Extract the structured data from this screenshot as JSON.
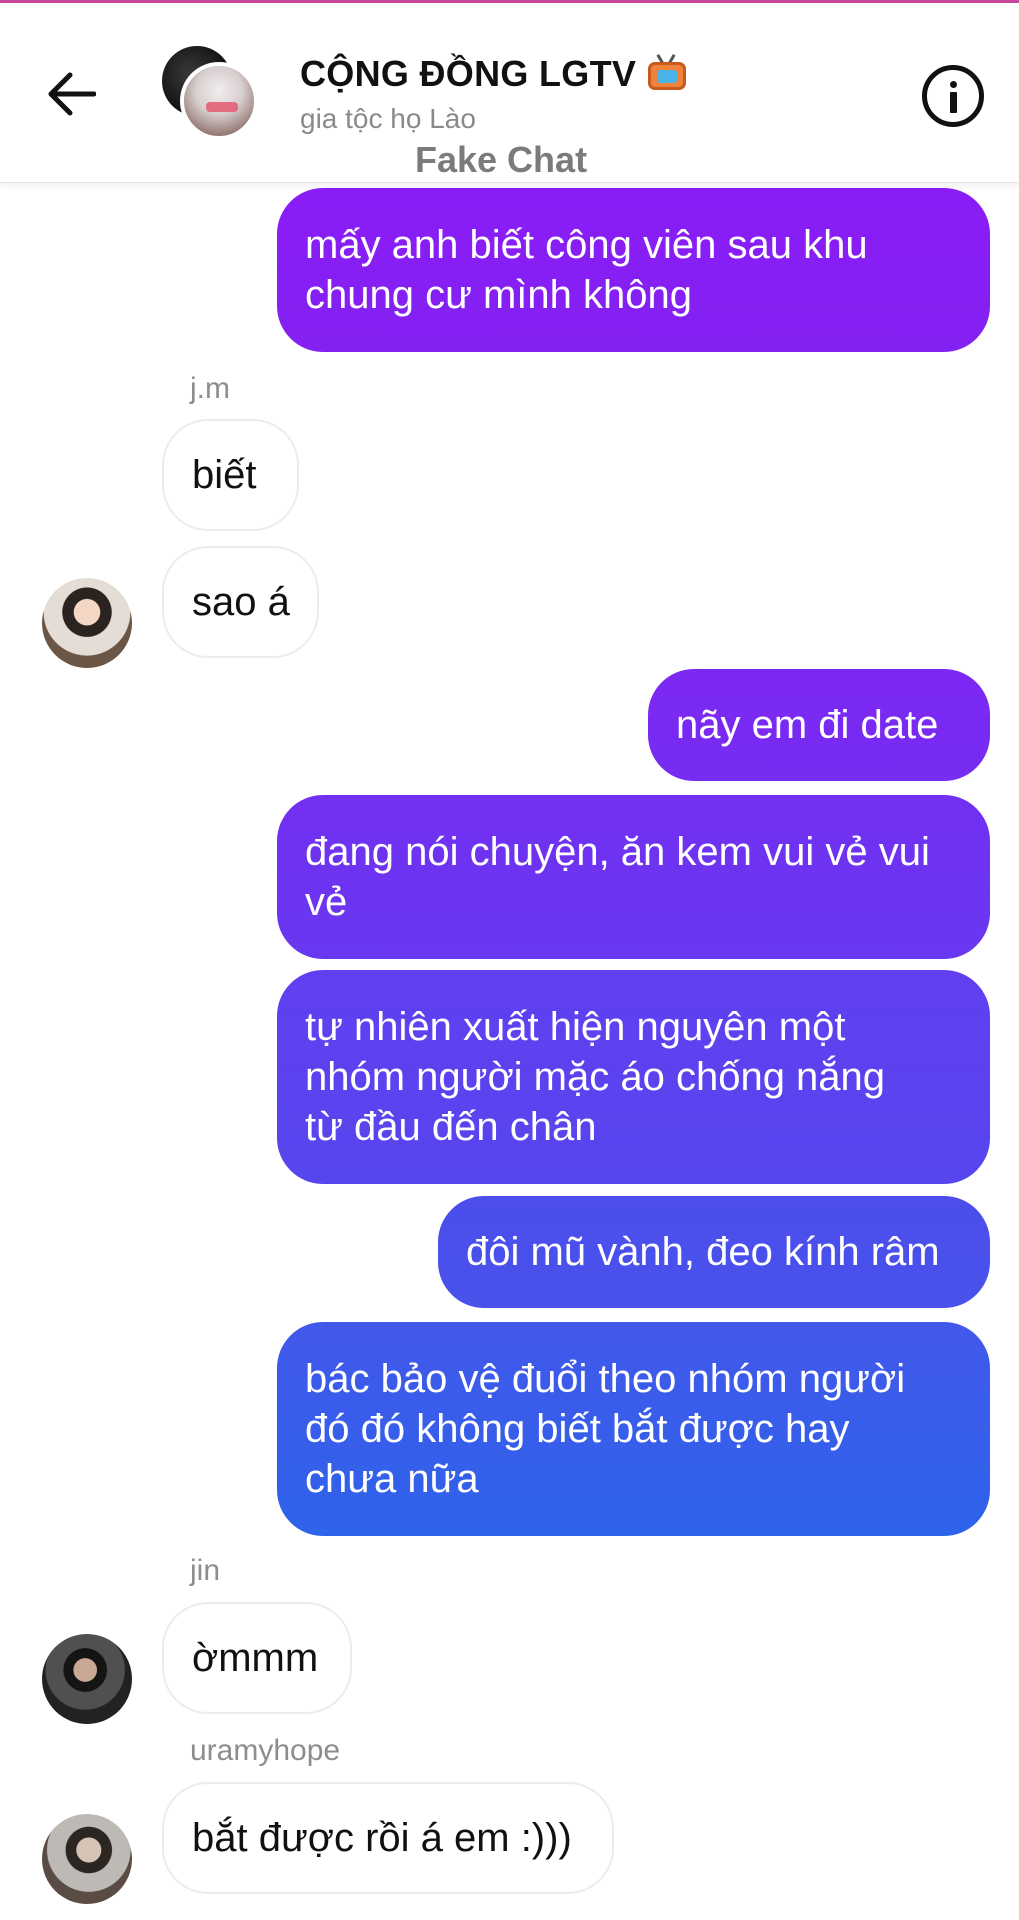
{
  "header": {
    "title": "CỘNG ĐỒNG LGTV",
    "subtitle": "gia tộc họ Lào",
    "watermark": "Fake Chat",
    "back_icon": "back-arrow-icon",
    "info_icon": "info-icon",
    "title_emoji": "tv-icon"
  },
  "colors": {
    "outgoing_top": "#8a1cf6",
    "outgoing_bottom": "#2d63ea",
    "incoming_bg": "#ffffff",
    "sender_label": "#8d8d8d"
  },
  "messages": [
    {
      "direction": "out",
      "lines": [
        "mấy anh biết công viên sau khu",
        "chung cư mình không"
      ]
    },
    {
      "direction": "in",
      "sender": "j.m",
      "lines": [
        "biết"
      ]
    },
    {
      "direction": "in",
      "lines": [
        "sao á"
      ]
    },
    {
      "direction": "out",
      "lines": [
        "nãy em đi date"
      ]
    },
    {
      "direction": "out",
      "lines": [
        "đang nói chuyện, ăn kem vui vẻ vui",
        "vẻ"
      ]
    },
    {
      "direction": "out",
      "lines": [
        "tự nhiên xuất hiện nguyên một",
        "nhóm người mặc áo chống nắng",
        "từ đầu đến chân"
      ]
    },
    {
      "direction": "out",
      "lines": [
        "đôi mũ vành, đeo kính râm"
      ]
    },
    {
      "direction": "out",
      "lines": [
        "bác bảo vệ đuổi theo nhóm người",
        "đó đó không biết bắt được hay",
        "chưa nữa"
      ]
    },
    {
      "direction": "in",
      "sender": "jin",
      "lines": [
        "ờmmm"
      ]
    },
    {
      "direction": "in",
      "sender": "uramyhope",
      "lines": [
        "bắt được rồi á em :)))"
      ]
    }
  ]
}
